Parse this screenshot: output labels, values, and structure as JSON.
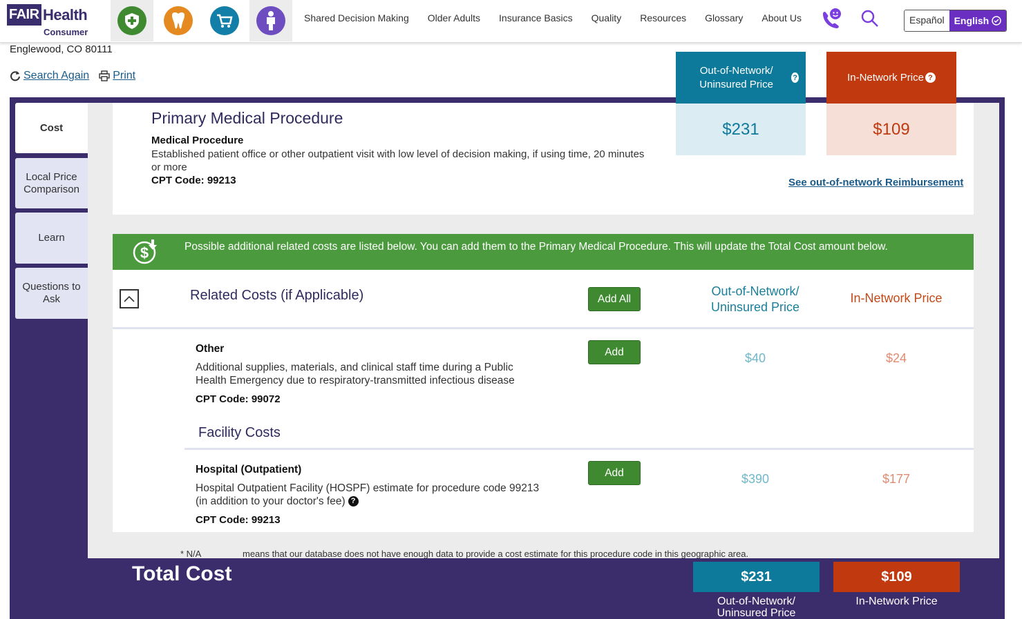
{
  "brand": {
    "fair": "FAIR",
    "health": "Health",
    "consumer": "Consumer"
  },
  "nav": {
    "icons": [
      "medical-icon",
      "dental-icon",
      "cart-icon",
      "person-icon"
    ],
    "links": [
      "Shared Decision Making",
      "Older Adults",
      "Insurance Basics",
      "Quality",
      "Resources",
      "Glossary",
      "About Us"
    ],
    "lang_es": "Español",
    "lang_en": "English"
  },
  "location": "Englewood, CO 80111",
  "actions": {
    "search_again": "Search Again",
    "print": "Print"
  },
  "tabs": [
    "Cost",
    "Local Price Comparison",
    "Learn",
    "Questions to Ask"
  ],
  "primary": {
    "title": "Primary Medical Procedure",
    "label": "Medical Procedure",
    "description": "Established patient office or other outpatient visit with low level of decision making, if using time, 20 minutes or more",
    "cpt": "CPT Code: 99213",
    "reimbursement_link": "See out-of-network Reimbursement"
  },
  "price_boxes": {
    "oon_label": "Out-of-Network/ Uninsured Price",
    "oon_value": "$231",
    "in_label": "In-Network Price",
    "in_value": "$109"
  },
  "banner": "Possible additional related costs are listed below. You can add them to the Primary Medical Procedure. This will update the Total Cost amount below.",
  "related": {
    "title": "Related Costs (if Applicable)",
    "add_all": "Add All",
    "col_oon": "Out-of-Network/ Uninsured Price",
    "col_in": "In-Network Price",
    "items": [
      {
        "name": "Other",
        "description": "Additional supplies, materials, and clinical staff time during a Public Health Emergency due to respiratory-transmitted infectious disease",
        "cpt": "CPT Code: 99072",
        "add": "Add",
        "oon": "$40",
        "in": "$24"
      }
    ],
    "facility_title": "Facility Costs",
    "facility_items": [
      {
        "name": "Hospital (Outpatient)",
        "description": "Hospital Outpatient Facility (HOSPF) estimate for procedure code 99213 (in addition to your doctor's fee)",
        "cpt": "CPT Code: 99213",
        "add": "Add",
        "oon": "$390",
        "in": "$177"
      }
    ]
  },
  "footnote": {
    "key": "* N/A",
    "text": "means that our database does not have enough data to provide a cost estimate for this procedure code in this geographic area."
  },
  "total": {
    "label": "Total Cost",
    "oon_value": "$231",
    "oon_label": "Out-of-Network/ Uninsured Price",
    "in_value": "$109",
    "in_label": "In-Network Price"
  },
  "colors": {
    "purple": "#3b2c6b",
    "teal": "#0e7a9b",
    "rust": "#c0390f",
    "green": "#4c9a3e"
  }
}
